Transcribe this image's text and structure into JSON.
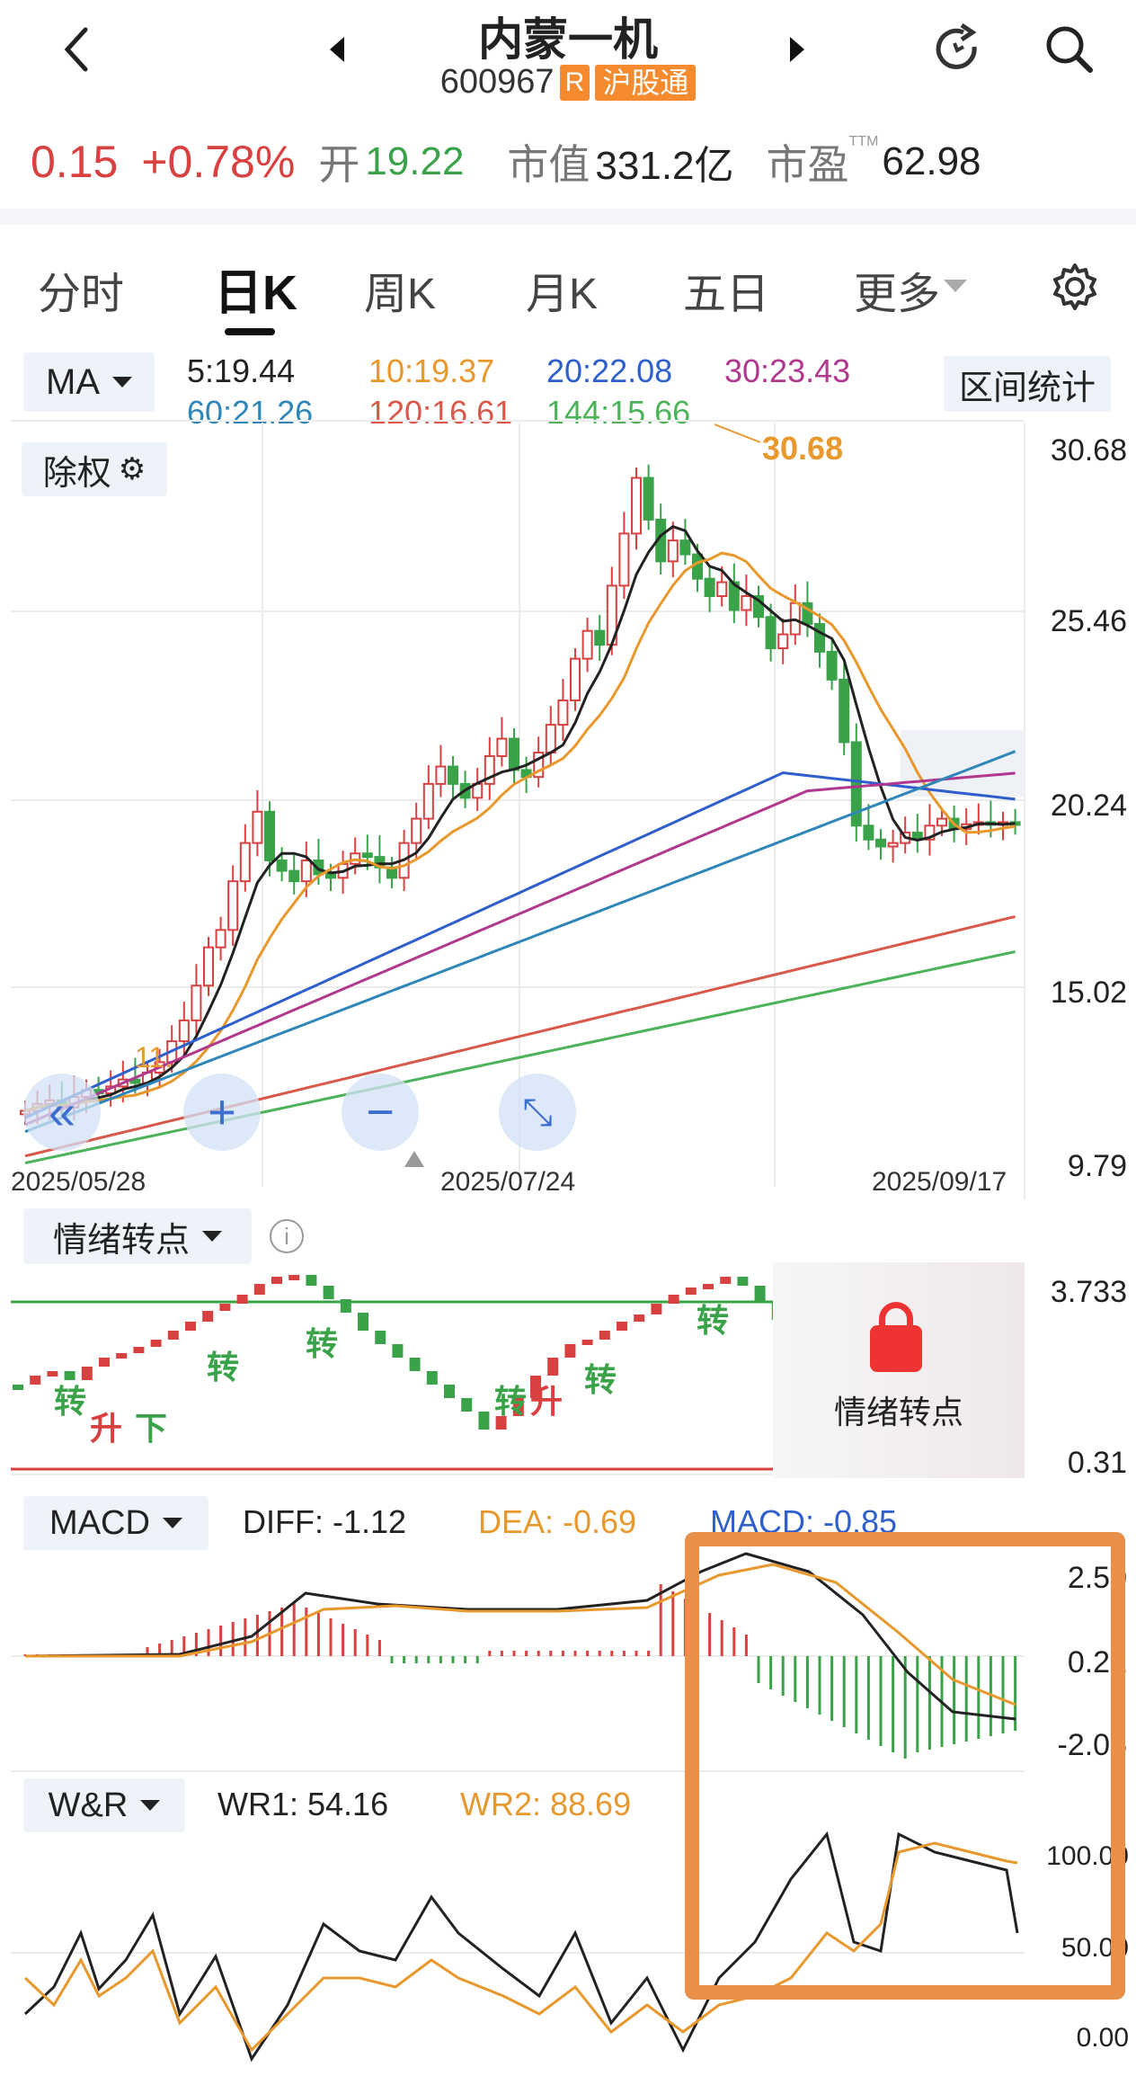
{
  "header": {
    "title": "内蒙一机",
    "code": "600967",
    "r_badge": "R",
    "hgt_badge": "沪股通"
  },
  "quote": {
    "change": "0.15",
    "change_pct": "+0.78%",
    "open_label": "开",
    "open_value": "19.22",
    "mktcap_label": "市值",
    "mktcap_value": "331.2亿",
    "pe_label": "市盈",
    "pe_sup": "TTM",
    "pe_value": "62.98"
  },
  "tabs": [
    "分时",
    "日K",
    "周K",
    "月K",
    "五日",
    "更多"
  ],
  "ma_panel": {
    "selector": "MA",
    "interval_stats": "区间统计",
    "ma5": "5:19.44",
    "ma10": "10:19.37",
    "ma20": "20:22.08",
    "ma30": "30:23.43",
    "ma60": "60:21.26",
    "ma120": "120:16.61",
    "ma144": "144:15.66",
    "exright": "除权",
    "high_marker": "30.68",
    "low_marker": "11.",
    "axis": [
      "30.68",
      "25.46",
      "20.24",
      "15.02",
      "9.79"
    ],
    "dates": [
      "2025/05/28",
      "2025/07/24",
      "2025/09/17"
    ]
  },
  "emotion_panel": {
    "label": "情绪转点",
    "axis": [
      "3.733",
      "0.31"
    ],
    "lock_label": "情绪转点",
    "markers": [
      "转",
      "升",
      "下",
      "转",
      "转",
      "转",
      "升",
      "转",
      "转"
    ]
  },
  "macd_panel": {
    "selector": "MACD",
    "diff": "DIFF: -1.12",
    "dea": "DEA: -0.69",
    "macd": "MACD: -0.85",
    "axis": [
      "2.50",
      "0.22",
      "-2.06"
    ]
  },
  "wr_panel": {
    "selector": "W&R",
    "wr1": "WR1: 54.16",
    "wr2": "WR2: 88.69",
    "axis": [
      "100.00",
      "50.00",
      "0.00"
    ]
  },
  "colors": {
    "up": "#d94040",
    "down": "#3aa34a",
    "ma5": "#222222",
    "ma10": "#e8982c",
    "ma20": "#2e5fcc",
    "ma30": "#b0388f",
    "ma60": "#2f86b8",
    "ma120": "#d9584a",
    "ma144": "#4cb35a",
    "highlight": "#e8904a"
  }
}
